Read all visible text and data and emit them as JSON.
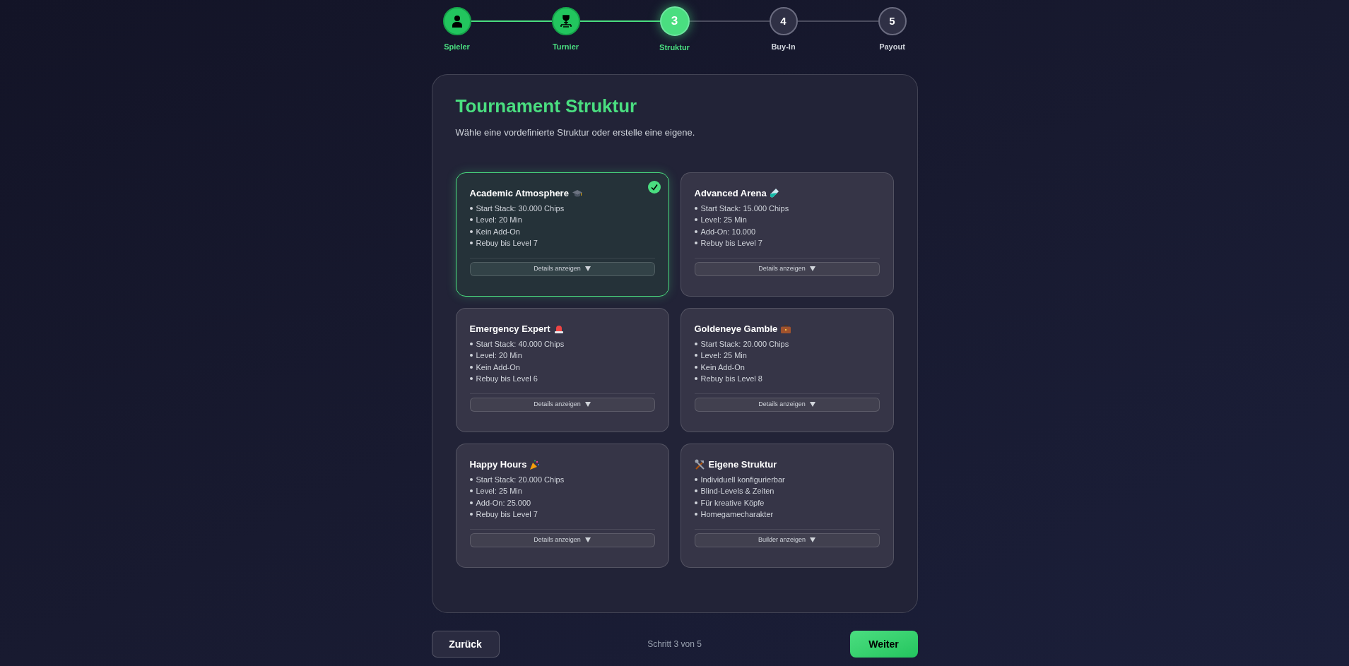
{
  "steps": [
    {
      "label": "Spieler",
      "kind": "done"
    },
    {
      "label": "Turnier",
      "kind": "done"
    },
    {
      "label": "Struktur",
      "number": "3",
      "kind": "current"
    },
    {
      "label": "Buy-In",
      "number": "4",
      "kind": "upcoming"
    },
    {
      "label": "Payout",
      "number": "5",
      "kind": "upcoming"
    }
  ],
  "panel": {
    "title": "Tournament Struktur",
    "subtitle": "Wähle eine vordefinierte Struktur oder erstelle eine eigene."
  },
  "cards": [
    {
      "kind": "preset",
      "title": "Academic Atmosphere",
      "selected": true,
      "items": [
        "Start Stack: 30.000 Chips",
        "Level: 20 Min",
        "Kein Add-On",
        "Rebuy bis Level 7"
      ],
      "button": "Details anzeigen"
    },
    {
      "kind": "preset",
      "title": "Advanced Arena",
      "selected": false,
      "items": [
        "Start Stack: 15.000 Chips",
        "Level: 25 Min",
        "Add-On: 10.000",
        "Rebuy bis Level 7"
      ],
      "button": "Details anzeigen"
    },
    {
      "kind": "preset",
      "title": "Emergency Expert",
      "selected": false,
      "items": [
        "Start Stack: 40.000 Chips",
        "Level: 20 Min",
        "Kein Add-On",
        "Rebuy bis Level 6"
      ],
      "button": "Details anzeigen"
    },
    {
      "kind": "preset",
      "title": "Goldeneye Gamble",
      "selected": false,
      "items": [
        "Start Stack: 20.000 Chips",
        "Level: 25 Min",
        "Kein Add-On",
        "Rebuy bis Level 8"
      ],
      "button": "Details anzeigen"
    },
    {
      "kind": "preset",
      "title": "Happy Hours",
      "selected": false,
      "items": [
        "Start Stack: 20.000 Chips",
        "Level: 25 Min",
        "Add-On: 25.000",
        "Rebuy bis Level 7"
      ],
      "button": "Details anzeigen"
    },
    {
      "kind": "custom",
      "title": "Eigene Struktur",
      "selected": false,
      "items": [
        "Individuell konfigurierbar",
        "Blind-Levels & Zeiten",
        "Für kreative Köpfe",
        "Homegamecharakter"
      ],
      "button": "Builder anzeigen"
    }
  ],
  "footer": {
    "back": "Zurück",
    "progress": "Schritt 3 von 5",
    "next": "Weiter"
  }
}
